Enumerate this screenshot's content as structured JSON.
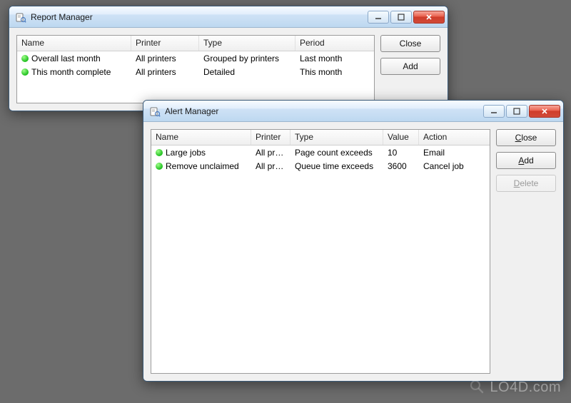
{
  "report_window": {
    "title": "Report Manager",
    "columns": {
      "name": "Name",
      "printer": "Printer",
      "type": "Type",
      "period": "Period"
    },
    "rows": [
      {
        "name": "Overall last month",
        "printer": "All printers",
        "type": "Grouped by printers",
        "period": "Last month"
      },
      {
        "name": "This month complete",
        "printer": "All printers",
        "type": "Detailed",
        "period": "This month"
      }
    ],
    "buttons": {
      "close": "Close",
      "add": "Add"
    }
  },
  "alert_window": {
    "title": "Alert Manager",
    "columns": {
      "name": "Name",
      "printer": "Printer",
      "type": "Type",
      "value": "Value",
      "action": "Action"
    },
    "rows": [
      {
        "name": "Large jobs",
        "printer": "All pr…",
        "type": "Page count exceeds",
        "value": "10",
        "action": "Email"
      },
      {
        "name": "Remove unclaimed",
        "printer": "All pr…",
        "type": "Queue time exceeds",
        "value": "3600",
        "action": "Cancel job"
      }
    ],
    "buttons": {
      "close_pre": "C",
      "close_post": "lose",
      "add_pre": "A",
      "add_post": "dd",
      "delete_pre": "D",
      "delete_post": "elete"
    }
  },
  "watermark": "LO4D.com"
}
